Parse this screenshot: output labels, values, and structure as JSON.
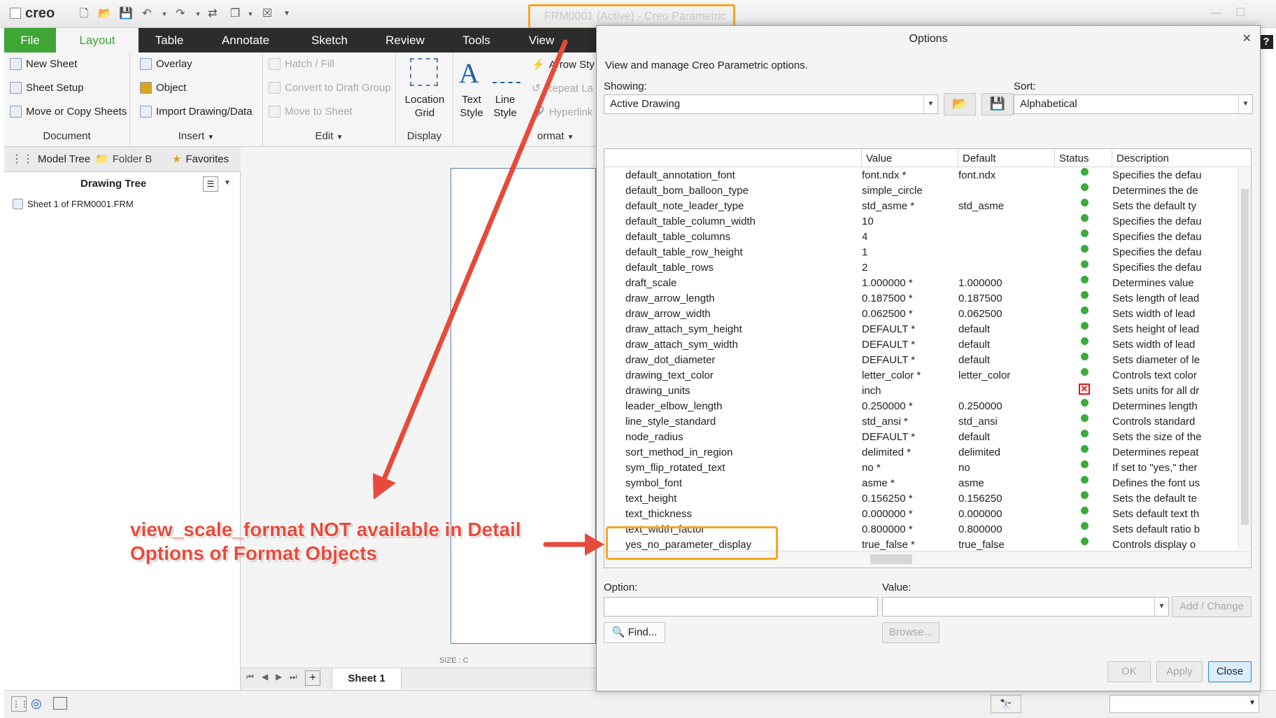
{
  "app": {
    "logo": "creo",
    "title": "FRM0001 (Active) - Creo Parametric"
  },
  "tabs": [
    "File",
    "Layout",
    "Table",
    "Annotate",
    "Sketch",
    "Review",
    "Tools",
    "View"
  ],
  "ribbon": {
    "document": {
      "label": "Document",
      "items": [
        "New Sheet",
        "Sheet Setup",
        "Move or Copy Sheets"
      ]
    },
    "insert": {
      "label": "Insert",
      "items": [
        "Overlay",
        "Object",
        "Import Drawing/Data"
      ]
    },
    "edit": {
      "label": "Edit",
      "items": [
        "Hatch / Fill",
        "Convert to Draft Group",
        "Move to Sheet"
      ]
    },
    "display": {
      "label": "Display",
      "location_grid": "Location Grid"
    },
    "format": {
      "label": "ormat",
      "text_style": "Text Style",
      "line_style": "Line Style",
      "items": [
        "Arrow Sty",
        "Repeat La",
        "Hyperlink"
      ]
    }
  },
  "navtabs": [
    "Model Tree",
    "Folder B",
    "Favorites"
  ],
  "tree": {
    "title": "Drawing Tree",
    "item": "Sheet 1 of FRM0001.FRM"
  },
  "canvas": {
    "size_label": "SIZE : C"
  },
  "sheetbar": {
    "sheet": "Sheet 1"
  },
  "dialog": {
    "title": "Options",
    "subtitle": "View and manage Creo Parametric options.",
    "showing_label": "Showing:",
    "showing_value": "Active Drawing",
    "sort_label": "Sort:",
    "sort_value": "Alphabetical",
    "columns": [
      "Value",
      "Default",
      "Status",
      "Description"
    ],
    "rows": [
      {
        "name": "default_annotation_font",
        "value": "font.ndx *",
        "default": "font.ndx",
        "status": "ok",
        "desc": "Specifies the defau"
      },
      {
        "name": "default_bom_balloon_type",
        "value": "simple_circle",
        "default": "",
        "status": "ok",
        "desc": "Determines the de"
      },
      {
        "name": "default_note_leader_type",
        "value": "std_asme *",
        "default": "std_asme",
        "status": "ok",
        "desc": "Sets the default ty"
      },
      {
        "name": "default_table_column_width",
        "value": "10",
        "default": "",
        "status": "ok",
        "desc": "Specifies the defau"
      },
      {
        "name": "default_table_columns",
        "value": "4",
        "default": "",
        "status": "ok",
        "desc": "Specifies the defau"
      },
      {
        "name": "default_table_row_height",
        "value": "1",
        "default": "",
        "status": "ok",
        "desc": "Specifies the defau"
      },
      {
        "name": "default_table_rows",
        "value": "2",
        "default": "",
        "status": "ok",
        "desc": "Specifies the defau"
      },
      {
        "name": "draft_scale",
        "value": "1.000000 *",
        "default": "1.000000",
        "status": "ok",
        "desc": "Determines value"
      },
      {
        "name": "draw_arrow_length",
        "value": "0.187500 *",
        "default": "0.187500",
        "status": "ok",
        "desc": "Sets length of lead"
      },
      {
        "name": "draw_arrow_width",
        "value": "0.062500 *",
        "default": "0.062500",
        "status": "ok",
        "desc": "Sets width of lead"
      },
      {
        "name": "draw_attach_sym_height",
        "value": "DEFAULT *",
        "default": "default",
        "status": "ok",
        "desc": "Sets height of lead"
      },
      {
        "name": "draw_attach_sym_width",
        "value": "DEFAULT *",
        "default": "default",
        "status": "ok",
        "desc": "Sets width of lead"
      },
      {
        "name": "draw_dot_diameter",
        "value": "DEFAULT *",
        "default": "default",
        "status": "ok",
        "desc": "Sets diameter of le"
      },
      {
        "name": "drawing_text_color",
        "value": "letter_color *",
        "default": "letter_color",
        "status": "ok",
        "desc": "Controls text color"
      },
      {
        "name": "drawing_units",
        "value": "inch",
        "default": "",
        "status": "error",
        "desc": "Sets units for all dr"
      },
      {
        "name": "leader_elbow_length",
        "value": "0.250000 *",
        "default": "0.250000",
        "status": "ok",
        "desc": "Determines length"
      },
      {
        "name": "line_style_standard",
        "value": "std_ansi *",
        "default": "std_ansi",
        "status": "ok",
        "desc": "Controls standard"
      },
      {
        "name": "node_radius",
        "value": "DEFAULT *",
        "default": "default",
        "status": "ok",
        "desc": "Sets the size of the"
      },
      {
        "name": "sort_method_in_region",
        "value": "delimited *",
        "default": "delimited",
        "status": "ok",
        "desc": "Determines repeat"
      },
      {
        "name": "sym_flip_rotated_text",
        "value": "no *",
        "default": "no",
        "status": "ok",
        "desc": "If set to \"yes,\" ther"
      },
      {
        "name": "symbol_font",
        "value": "asme *",
        "default": "asme",
        "status": "ok",
        "desc": "Defines the font us"
      },
      {
        "name": "text_height",
        "value": "0.156250 *",
        "default": "0.156250",
        "status": "ok",
        "desc": "Sets the default te"
      },
      {
        "name": "text_thickness",
        "value": "0.000000 *",
        "default": "0.000000",
        "status": "ok",
        "desc": "Sets default text th"
      },
      {
        "name": "text_width_factor",
        "value": "0.800000 *",
        "default": "0.800000",
        "status": "ok",
        "desc": "Sets default ratio b"
      },
      {
        "name": "yes_no_parameter_display",
        "value": "true_false *",
        "default": "true_false",
        "status": "ok",
        "desc": "Controls display o"
      }
    ],
    "option_label": "Option:",
    "value_label": "Value:",
    "add_change": "Add / Change",
    "find": "Find...",
    "browse": "Browse...",
    "ok": "OK",
    "apply": "Apply",
    "close": "Close"
  },
  "annotation": {
    "line1": "view_scale_format NOT available in Detail",
    "line2": "Options of Format Objects"
  },
  "colors": {
    "accent": "#1e88e5",
    "file_tab": "#3fa535",
    "highlight": "#f5a623",
    "arrow": "#e74a3b",
    "status_ok": "#3caa3c",
    "status_error": "#e11111"
  }
}
